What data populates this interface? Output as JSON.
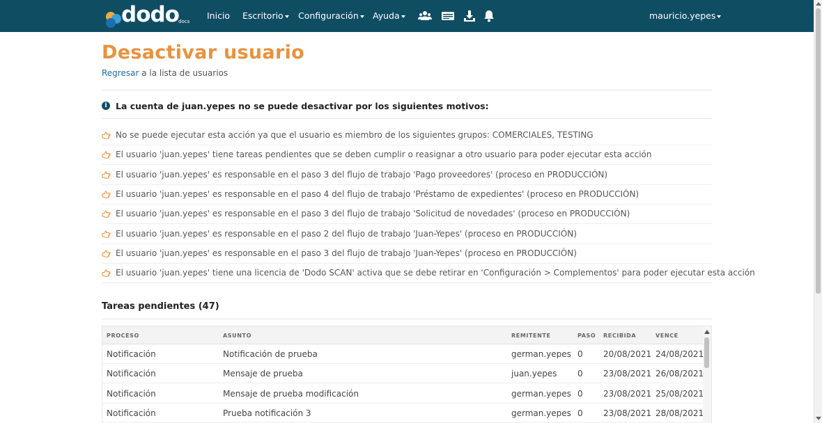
{
  "navbar": {
    "logo_text": "dodo",
    "logo_sub": "docs",
    "items": [
      {
        "label": "Inicio"
      },
      {
        "label": "Escritorio"
      },
      {
        "label": "Configuración"
      },
      {
        "label": "Ayuda"
      }
    ],
    "icons": [
      "users-icon",
      "card-icon",
      "download-icon",
      "bell-icon"
    ],
    "user": "mauricio.yepes",
    "bg_color": "#0f4d63"
  },
  "page": {
    "title": "Desactivar usuario",
    "title_color": "#e8923e",
    "back_link": "Regresar",
    "back_rest": " a la lista de usuarios"
  },
  "alert": {
    "prefix": "La cuenta de ",
    "username": "juan.yepes",
    "suffix": " no se puede desactivar por los siguientes motivos:"
  },
  "reasons": [
    "No se puede ejecutar esta acción ya que el usuario es miembro de los siguientes grupos: COMERCIALES, TESTING",
    "El usuario 'juan.yepes' tiene tareas pendientes que se deben cumplir o reasignar a otro usuario para poder ejecutar esta acción",
    "El usuario 'juan.yepes' es responsable en el paso 3 del flujo de trabajo 'Pago proveedores' (proceso en PRODUCCIÓN)",
    "El usuario 'juan.yepes' es responsable en el paso 4 del flujo de trabajo 'Préstamo de expedientes' (proceso en PRODUCCIÓN)",
    "El usuario 'juan.yepes' es responsable en el paso 3 del flujo de trabajo 'Solicitud de novedades' (proceso en PRODUCCIÓN)",
    "El usuario 'juan.yepes' es responsable en el paso 2 del flujo de trabajo 'Juan-Yepes' (proceso en PRODUCCIÓN)",
    "El usuario 'juan.yepes' es responsable en el paso 3 del flujo de trabajo 'Juan-Yepes' (proceso en PRODUCCIÓN)",
    "El usuario 'juan.yepes' tiene una licencia de 'Dodo SCAN' activa que se debe retirar en 'Configuración > Complementos' para poder ejecutar esta acción"
  ],
  "tasks": {
    "title": "Tareas pendientes (47)",
    "columns": [
      "PROCESO",
      "ASUNTO",
      "REMITENTE",
      "PASO",
      "RECIBIDA",
      "VENCE"
    ],
    "rows": [
      [
        "Notificación",
        "Notificación de prueba",
        "german.yepes",
        "0",
        "20/08/2021",
        "24/08/2021"
      ],
      [
        "Notificación",
        "Mensaje de prueba",
        "juan.yepes",
        "0",
        "23/08/2021",
        "26/08/2021"
      ],
      [
        "Notificación",
        "Mensaje de prueba modificación",
        "german.yepes",
        "0",
        "23/08/2021",
        "25/08/2021"
      ],
      [
        "Notificación",
        "Prueba notificación 3",
        "german.yepes",
        "0",
        "23/08/2021",
        "28/08/2021"
      ]
    ]
  }
}
